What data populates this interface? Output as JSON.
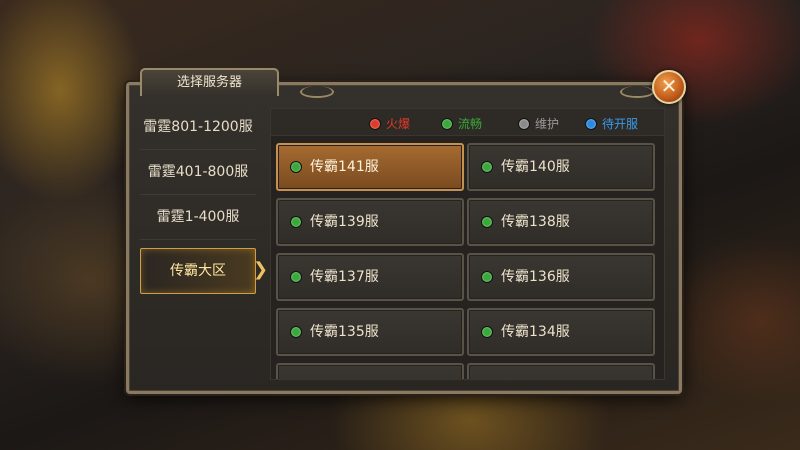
{
  "dialog": {
    "title": "选择服务器",
    "close_glyph": "✕"
  },
  "sidebar": {
    "items": [
      {
        "label": "雷霆801-1200服"
      },
      {
        "label": "雷霆401-800服"
      },
      {
        "label": "雷霆1-400服"
      },
      {
        "label": "传霸大区",
        "active": true
      }
    ]
  },
  "legend": [
    {
      "label": "火爆",
      "color": "#e03a2a"
    },
    {
      "label": "流畅",
      "color": "#3aa83a"
    },
    {
      "label": "维护",
      "color": "#8a8a8a"
    },
    {
      "label": "待开服",
      "color": "#2a8ae0"
    }
  ],
  "servers": [
    {
      "name": "传霸141服",
      "status": "流畅",
      "selected": true
    },
    {
      "name": "传霸140服",
      "status": "流畅"
    },
    {
      "name": "传霸139服",
      "status": "流畅"
    },
    {
      "name": "传霸138服",
      "status": "流畅"
    },
    {
      "name": "传霸137服",
      "status": "流畅"
    },
    {
      "name": "传霸136服",
      "status": "流畅"
    },
    {
      "name": "传霸135服",
      "status": "流畅"
    },
    {
      "name": "传霸134服",
      "status": "流畅"
    }
  ],
  "colors": {
    "accent": "#c89050",
    "panel_border": "#8a7a62"
  },
  "icons": {
    "close": "close-icon",
    "arrow": "chevron-right-icon"
  }
}
